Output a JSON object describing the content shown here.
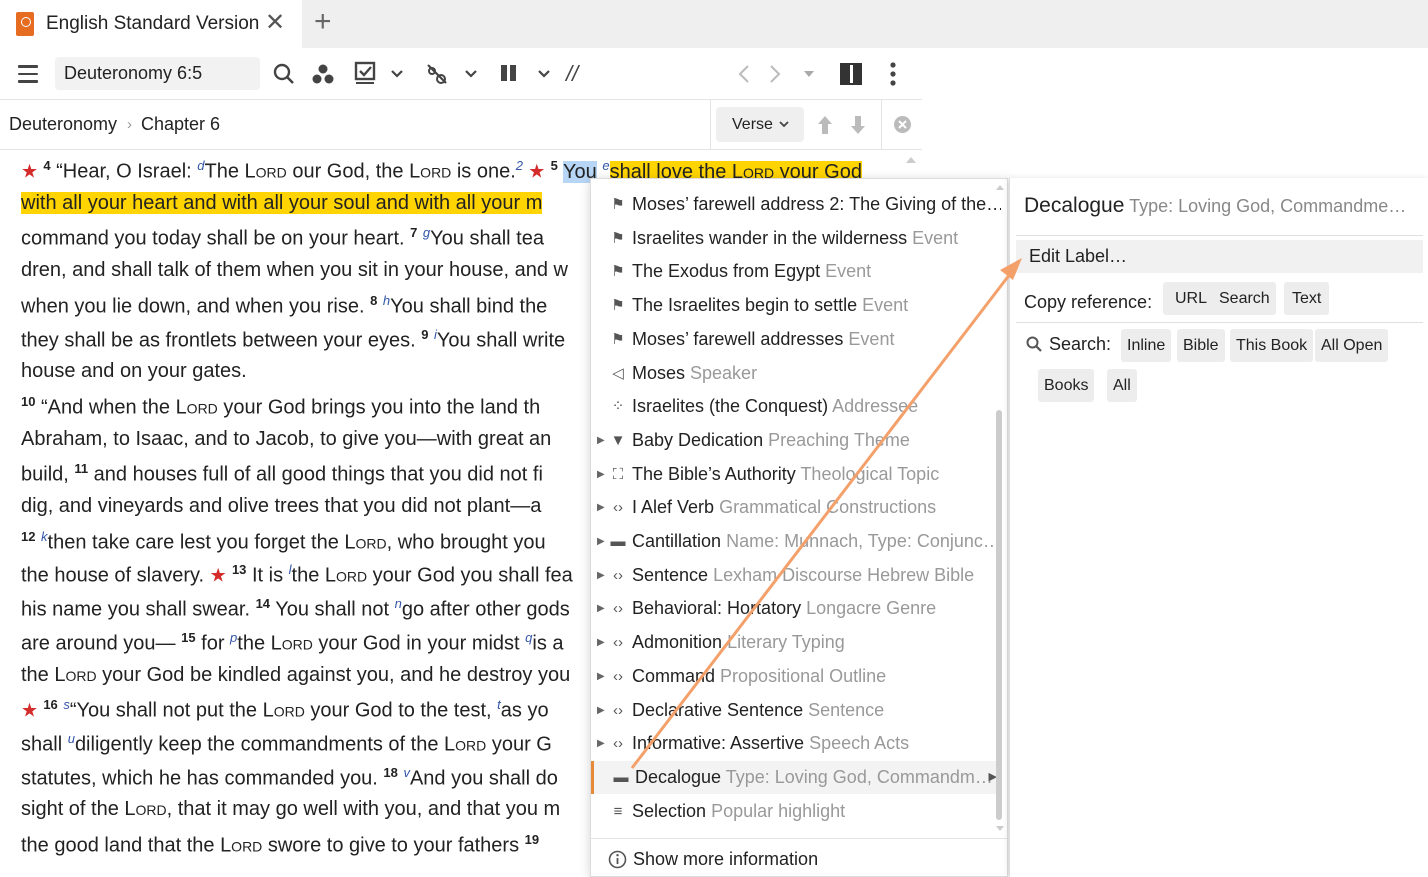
{
  "tab": {
    "title": "English Standard Version",
    "close": "✕",
    "add": "+"
  },
  "toolbar": {
    "reference": "Deuteronomy 6:5",
    "parallel_label": "//"
  },
  "breadcrumb": {
    "book": "Deuteronomy",
    "sep": "›",
    "chapter": "Chapter 6",
    "verse_button": "Verse"
  },
  "text_lines": [
    [
      {
        "t": "★ ",
        "c": "star"
      },
      {
        "t": "4",
        "c": "v"
      },
      {
        "t": " “Hear, O Israel: "
      },
      {
        "t": "d",
        "c": "fn"
      },
      {
        "t": "The "
      },
      {
        "t": "Lord",
        "c": "sc"
      },
      {
        "t": " our God, the "
      },
      {
        "t": "Lord",
        "c": "sc"
      },
      {
        "t": " is one."
      },
      {
        "t": "2",
        "c": "fn"
      },
      {
        "t": " ★ ",
        "c": "star"
      },
      {
        "t": "5",
        "c": "v"
      },
      {
        "t": " "
      },
      {
        "t": "You",
        "c": "sel"
      },
      {
        "t": " "
      },
      {
        "t": "e",
        "c": "fn"
      },
      {
        "t": "shall love the ",
        "c": "hl"
      },
      {
        "t": "Lord",
        "c": "hl sc"
      },
      {
        "t": " your God",
        "c": "hl"
      }
    ],
    [
      {
        "t": "with all your heart and with all your soul and with all your m",
        "c": "hl"
      }
    ],
    [
      {
        "t": "command you today shall be on your heart. "
      },
      {
        "t": "7",
        "c": "v"
      },
      {
        "t": " "
      },
      {
        "t": "g",
        "c": "fn"
      },
      {
        "t": "You shall tea"
      }
    ],
    [
      {
        "t": "dren, and shall talk of them when you sit in your house, and w"
      }
    ],
    [
      {
        "t": "when you lie down, and when you rise. "
      },
      {
        "t": "8",
        "c": "v"
      },
      {
        "t": " "
      },
      {
        "t": "h",
        "c": "fn"
      },
      {
        "t": "You shall bind the"
      }
    ],
    [
      {
        "t": "they shall be as frontlets between your eyes. "
      },
      {
        "t": "9",
        "c": "v"
      },
      {
        "t": " "
      },
      {
        "t": "i",
        "c": "fn"
      },
      {
        "t": "You shall write"
      }
    ],
    [
      {
        "t": "house and on your gates."
      }
    ],
    [
      {
        "t": "10",
        "c": "v"
      },
      {
        "t": " “And when the "
      },
      {
        "t": "Lord",
        "c": "sc"
      },
      {
        "t": " your God brings you into the land th"
      }
    ],
    [
      {
        "t": "Abraham, to Isaac, and to Jacob, to give you—with great an"
      }
    ],
    [
      {
        "t": "build, "
      },
      {
        "t": "11",
        "c": "v"
      },
      {
        "t": " and houses full of all good things that you did not fi"
      }
    ],
    [
      {
        "t": "dig, and vineyards and olive trees that you did not plant—a"
      }
    ],
    [
      {
        "t": "12",
        "c": "v"
      },
      {
        "t": " "
      },
      {
        "t": "k",
        "c": "fn"
      },
      {
        "t": "then take care lest you forget the "
      },
      {
        "t": "Lord",
        "c": "sc"
      },
      {
        "t": ", who brought you"
      }
    ],
    [
      {
        "t": "the house of slavery. "
      },
      {
        "t": "★ ",
        "c": "star"
      },
      {
        "t": "13",
        "c": "v"
      },
      {
        "t": " It is "
      },
      {
        "t": "l",
        "c": "fn"
      },
      {
        "t": "the "
      },
      {
        "t": "Lord",
        "c": "sc"
      },
      {
        "t": " your God you shall fea"
      }
    ],
    [
      {
        "t": "his name you shall swear. "
      },
      {
        "t": "14",
        "c": "v"
      },
      {
        "t": " You shall not "
      },
      {
        "t": "n",
        "c": "fn"
      },
      {
        "t": "go after other gods"
      }
    ],
    [
      {
        "t": "are around you— "
      },
      {
        "t": "15",
        "c": "v"
      },
      {
        "t": " for "
      },
      {
        "t": "p",
        "c": "fn"
      },
      {
        "t": "the "
      },
      {
        "t": "Lord",
        "c": "sc"
      },
      {
        "t": " your God in your midst "
      },
      {
        "t": "q",
        "c": "fn"
      },
      {
        "t": "is a"
      }
    ],
    [
      {
        "t": "the "
      },
      {
        "t": "Lord",
        "c": "sc"
      },
      {
        "t": " your God be kindled against you, and he destroy you"
      }
    ],
    [
      {
        "t": "★ ",
        "c": "star"
      },
      {
        "t": "16",
        "c": "v"
      },
      {
        "t": " "
      },
      {
        "t": "s",
        "c": "fn"
      },
      {
        "t": "“You shall not put the "
      },
      {
        "t": "Lord",
        "c": "sc"
      },
      {
        "t": " your God to the test, "
      },
      {
        "t": "t",
        "c": "fn"
      },
      {
        "t": "as yo"
      }
    ],
    [
      {
        "t": "shall "
      },
      {
        "t": "u",
        "c": "fn"
      },
      {
        "t": "diligently keep the commandments of the "
      },
      {
        "t": "Lord",
        "c": "sc"
      },
      {
        "t": " your G"
      }
    ],
    [
      {
        "t": "statutes, which he has commanded you. "
      },
      {
        "t": "18",
        "c": "v"
      },
      {
        "t": " "
      },
      {
        "t": "v",
        "c": "fn"
      },
      {
        "t": "And you shall do"
      }
    ],
    [
      {
        "t": "sight of the "
      },
      {
        "t": "Lord",
        "c": "sc"
      },
      {
        "t": ", that it may go well with you, and that you m"
      }
    ],
    [
      {
        "t": "the good land that the "
      },
      {
        "t": "Lord",
        "c": "sc"
      },
      {
        "t": " swore to give to your fathers "
      },
      {
        "t": "19",
        "c": "v"
      }
    ]
  ],
  "menu": {
    "items": [
      {
        "icon": "flag-icon",
        "glyph": "⚑",
        "label": "Moses’ farewell address 2: The Giving of the…",
        "sub": "",
        "caret": false
      },
      {
        "icon": "flag-icon",
        "glyph": "⚑",
        "label": "Israelites wander in the wilderness",
        "sub": " Event",
        "caret": false
      },
      {
        "icon": "flag-icon",
        "glyph": "⚑",
        "label": "The Exodus from Egypt",
        "sub": " Event",
        "caret": false
      },
      {
        "icon": "flag-icon",
        "glyph": "⚑",
        "label": "The Israelites begin to settle",
        "sub": " Event",
        "caret": false
      },
      {
        "icon": "flag-icon",
        "glyph": "⚑",
        "label": "Moses’ farewell addresses",
        "sub": " Event",
        "caret": false
      },
      {
        "icon": "megaphone-icon",
        "glyph": "◁",
        "label": "Moses",
        "sub": " Speaker",
        "caret": false
      },
      {
        "icon": "people-icon",
        "glyph": "⁘",
        "label": "Israelites (the Conquest)",
        "sub": " Addressee",
        "caret": false
      },
      {
        "icon": "pulpit-icon",
        "glyph": "▼",
        "label": "Baby Dedication",
        "sub": " Preaching Theme",
        "caret": true
      },
      {
        "icon": "hierarchy-icon",
        "glyph": "⛶",
        "label": "The Bible’s Authority",
        "sub": " Theological Topic",
        "caret": true
      },
      {
        "icon": "code-icon",
        "glyph": "‹›",
        "label": "I Alef Verb",
        "sub": " Grammatical Constructions",
        "caret": true
      },
      {
        "icon": "tag-icon",
        "glyph": "▬",
        "label": "Cantillation",
        "sub": " Name: Munnach, Type: Conjunc…",
        "caret": true
      },
      {
        "icon": "code-icon",
        "glyph": "‹›",
        "label": "Sentence",
        "sub": " Lexham Discourse Hebrew Bible",
        "caret": true
      },
      {
        "icon": "code-icon",
        "glyph": "‹›",
        "label": "Behavioral: Hortatory",
        "sub": " Longacre Genre",
        "caret": true
      },
      {
        "icon": "code-icon",
        "glyph": "‹›",
        "label": "Admonition",
        "sub": " Literary Typing",
        "caret": true
      },
      {
        "icon": "code-icon",
        "glyph": "‹›",
        "label": "Command",
        "sub": " Propositional Outline",
        "caret": true
      },
      {
        "icon": "code-icon",
        "glyph": "‹›",
        "label": "Declarative Sentence",
        "sub": " Sentence",
        "caret": true
      },
      {
        "icon": "code-icon",
        "glyph": "‹›",
        "label": "Informative: Assertive",
        "sub": " Speech Acts",
        "caret": true
      },
      {
        "icon": "tag-icon",
        "glyph": "▬",
        "label": "Decalogue",
        "sub": " Type: Loving God, Commandm…",
        "caret": false,
        "active": true
      },
      {
        "icon": "lines-icon",
        "glyph": "≡",
        "label": "Selection",
        "sub": " Popular highlight",
        "caret": false
      }
    ],
    "show_more": "Show more information"
  },
  "panel": {
    "title": "Decalogue",
    "title_sub": " Type: Loving God, Commandme…",
    "edit_label": "Edit Label…",
    "copy_label": "Copy reference:",
    "copy_options": [
      "URL",
      "Search",
      "Text"
    ],
    "search_label": "Search:",
    "search_options": [
      "Inline",
      "Bible",
      "This Book",
      "All Open",
      "Books",
      "All"
    ]
  },
  "colors": {
    "highlight": "#ffd400",
    "selection": "#b7d6f5",
    "accent": "#e68a3a",
    "star": "#d42b2b"
  }
}
